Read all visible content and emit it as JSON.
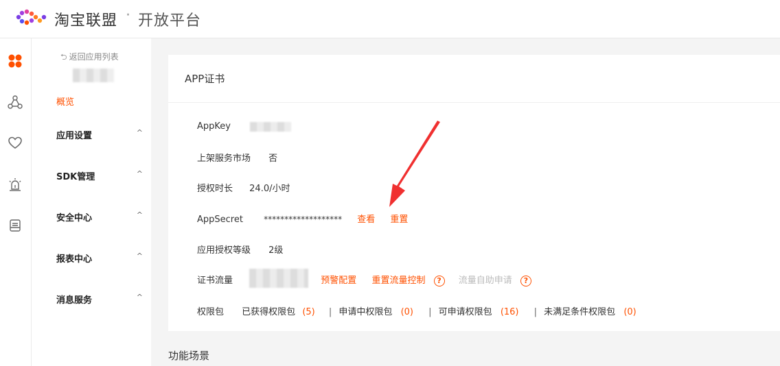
{
  "header": {
    "brand": "淘宝联盟",
    "separator": "·",
    "subtitle": "开放平台"
  },
  "rail": {
    "icons": [
      "apps-icon",
      "network-icon",
      "heart-icon",
      "alarm-icon",
      "document-icon"
    ]
  },
  "sidebar": {
    "back": "返回应用列表",
    "active": "概览",
    "items": [
      {
        "label": "应用设置",
        "chevron": "^"
      },
      {
        "label": "SDK管理",
        "chevron": "^"
      },
      {
        "label": "安全中心",
        "chevron": "^"
      },
      {
        "label": "报表中心",
        "chevron": "^"
      },
      {
        "label": "消息服务",
        "chevron": "^"
      }
    ]
  },
  "card": {
    "title": "APP证书",
    "rows": {
      "appkey": {
        "label": "AppKey"
      },
      "market": {
        "label": "上架服务市场",
        "value": "否"
      },
      "duration": {
        "label": "授权时长",
        "value": "24.0/小时"
      },
      "secret": {
        "label": "AppSecret",
        "value": "*******************",
        "view": "查看",
        "reset": "重置"
      },
      "level": {
        "label": "应用授权等级",
        "value": "2级"
      },
      "traffic": {
        "label": "证书流量",
        "alert": "预警配置",
        "reset_control": "重置流量控制",
        "self_apply": "流量自助申请",
        "help": "?"
      },
      "perm": {
        "label": "权限包",
        "obtained": "已获得权限包",
        "obtained_count": "(5)",
        "applying": "申请中权限包",
        "applying_count": "(0)",
        "available": "可申请权限包",
        "available_count": "(16)",
        "unmet": "未满足条件权限包",
        "unmet_count": "(0)",
        "pipe": "|"
      }
    }
  },
  "section2": {
    "title": "功能场景"
  },
  "colors": {
    "accent": "#ff5000",
    "annotation": "#f03030"
  }
}
